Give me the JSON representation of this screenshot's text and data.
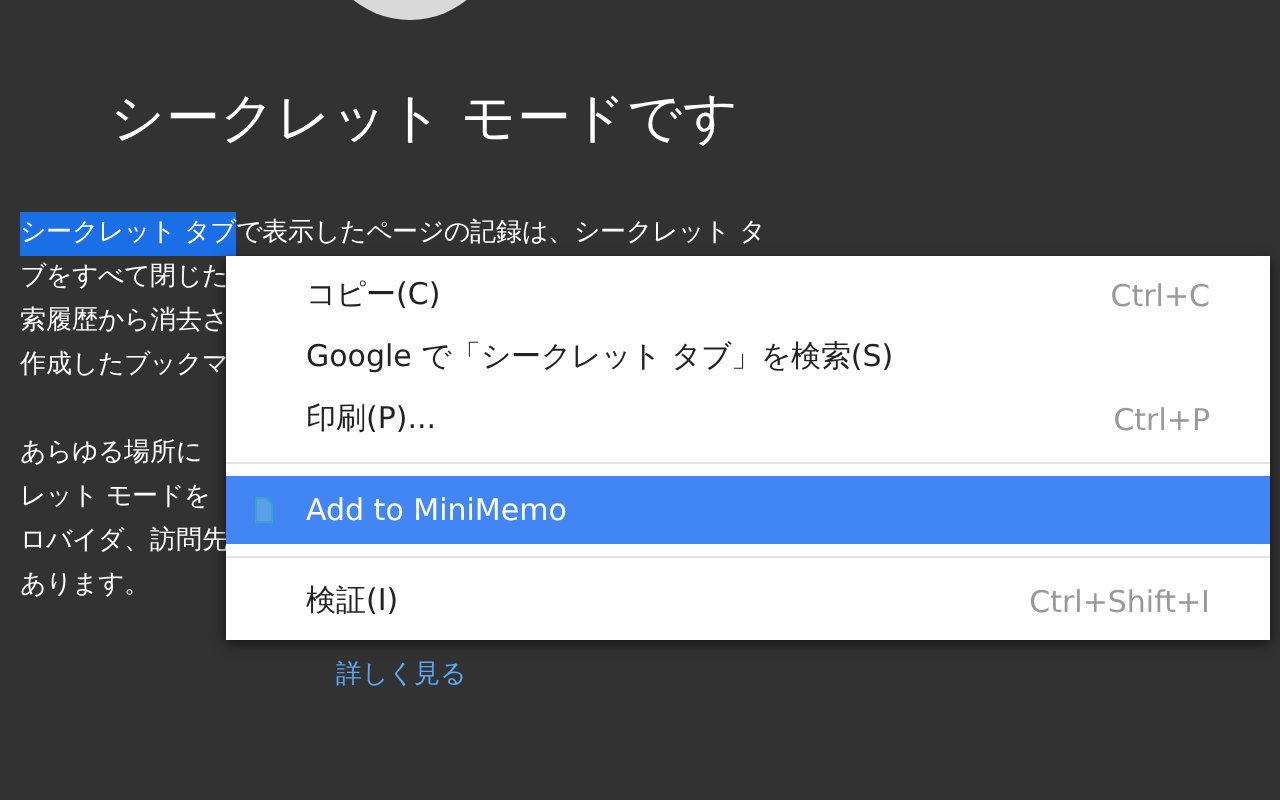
{
  "heading": "シークレット モードです",
  "paragraphs": [
    {
      "lines": [
        {
          "selected_text": "シークレット タブ",
          "text": "で表示したページの記録は、シークレット タ"
        },
        {
          "text": "ブをすべて閉じた"
        },
        {
          "text": "索履歴から消去さ"
        },
        {
          "text": "作成したブックマ"
        }
      ]
    },
    {
      "lines": [
        {
          "text": "あらゆる場所に"
        },
        {
          "text": "レット モードを"
        },
        {
          "text": "ロバイダ、訪問先"
        },
        {
          "text": "あります。"
        }
      ]
    }
  ],
  "link": "詳しく見る",
  "context_menu": {
    "items": [
      {
        "kind": "item",
        "label": "コピー(C)",
        "shortcut": "Ctrl+C",
        "selected": false
      },
      {
        "kind": "item",
        "label": "Google で「シークレット タブ」を検索(S)",
        "selected": false
      },
      {
        "kind": "item",
        "label": "印刷(P)...",
        "shortcut": "Ctrl+P",
        "selected": false
      },
      {
        "kind": "separator"
      },
      {
        "kind": "extension",
        "label": "Add to MiniMemo",
        "selected": true
      },
      {
        "kind": "separator"
      },
      {
        "kind": "item",
        "label": "検証(I)",
        "shortcut": "Ctrl+Shift+I",
        "selected": false
      }
    ]
  }
}
